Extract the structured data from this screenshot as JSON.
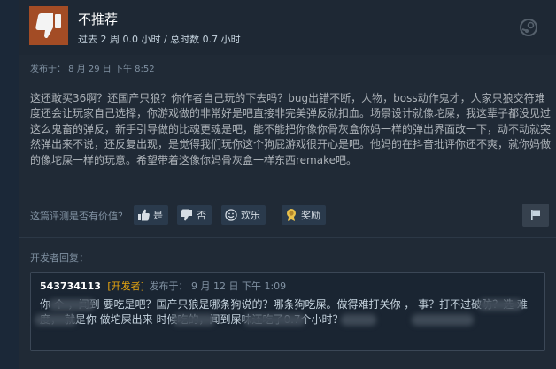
{
  "review": {
    "verdict": "不推荐",
    "hours": "过去 2 周 0.0 小时 / 总时数 0.7 小时",
    "posted": "发布于：  8 月 29 日 下午 8:52",
    "body": "这还敢买36啊？还国产只狼？你作者自己玩的下去吗？bug出错不断，人物，boss动作鬼才，人家只狼交符难度还会让玩家自己选择，你游戏做的非常好是吧直接非完美弹反就扣血。场景设计就像坨屎，我这辈子都没见过这么鬼畜的弹反，新手引导做的比魂更魂是吧，能不能把你像你骨灰盒你妈一样的弹出界面改一下，动不动就突然弹出来不说，还反复出现，是觉得我们玩你这个狗屁游戏很开心是吧。他妈的在抖音批评你还不爽，就你妈做的像坨屎一样的玩意。希望带着这像你妈骨灰盒一样东西remake吧。"
  },
  "helpful": {
    "question": "这篇评测是否有价值？",
    "yes": "是",
    "no": "否",
    "funny": "欢乐",
    "award": "奖励"
  },
  "developer": {
    "label": "开发者回复：",
    "name": "543734113",
    "badge": "[开发者]",
    "date": "发布于：  9 月 12 日 下午 1:09",
    "body": "你  个       ，闻到         要吃是吧？国产只狼是哪条狗说的？哪条狗吃屎。做得难打关你        ，   事？打不过破防？选                  难度，                        就是你      做坨屎出来                  时候吃的，闻到屎味还吃了0.7个小时？"
  },
  "colors": {
    "thumb_bg": "#a34c25",
    "dev_badge": "#e9a70f",
    "background": "#1b2838"
  },
  "icons": [
    "thumbs-down-icon",
    "steam-logo-icon",
    "thumbs-up-icon",
    "thumbs-down-icon",
    "smiley-icon",
    "award-icon",
    "flag-icon"
  ]
}
